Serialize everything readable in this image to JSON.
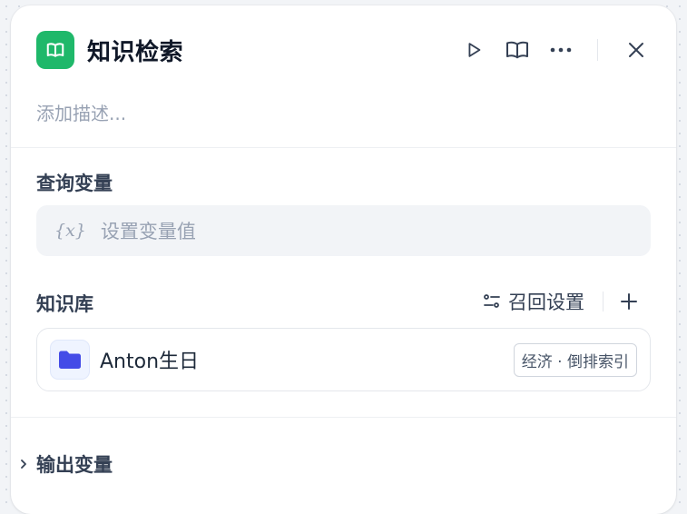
{
  "node": {
    "title": "知识检索",
    "icon": "book-open-icon",
    "accent_color": "#1fb86a",
    "description_placeholder": "添加描述..."
  },
  "header_actions": [
    "play-icon",
    "book-icon",
    "more-dots-icon",
    "close-icon"
  ],
  "query_section": {
    "label": "查询变量",
    "variable_icon_text": "{x}",
    "placeholder": "设置变量值"
  },
  "knowledge_section": {
    "label": "知识库",
    "recall_settings_label": "召回设置",
    "add_icon": "plus-icon",
    "items": [
      {
        "name": "Anton生日",
        "icon": "folder-icon",
        "icon_color": "#444ce7",
        "tag": "经济 · 倒排索引"
      }
    ]
  },
  "output_section": {
    "label": "输出变量",
    "expand_icon": "chevron-right-icon"
  }
}
